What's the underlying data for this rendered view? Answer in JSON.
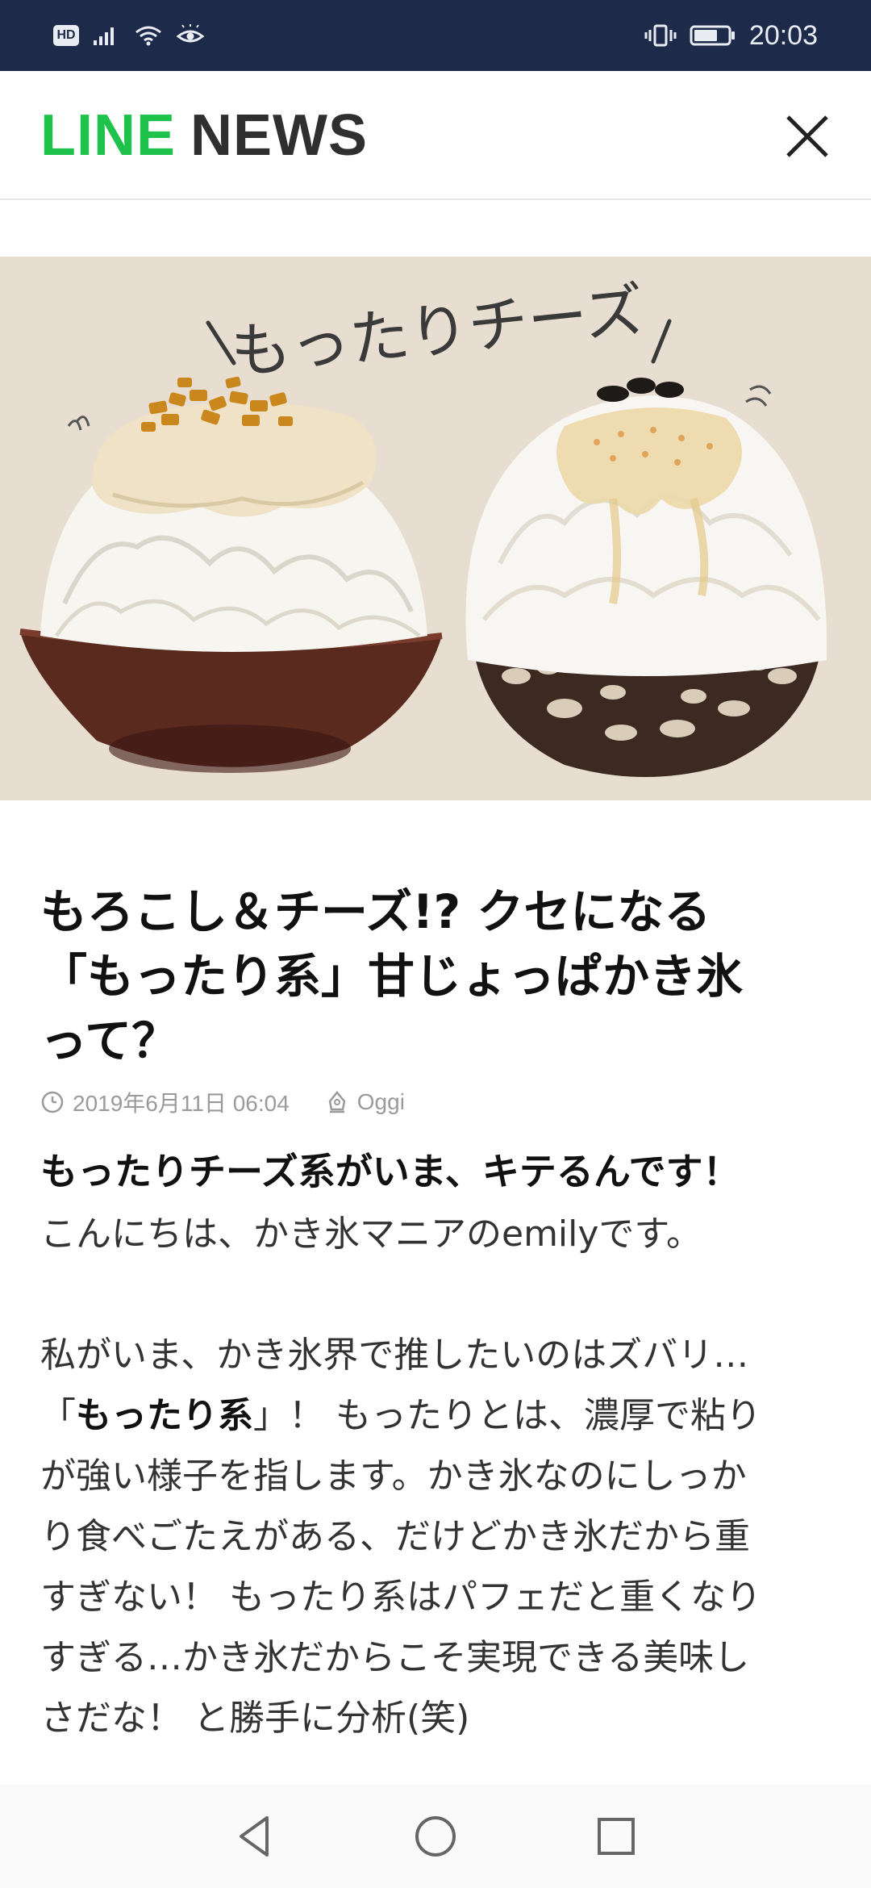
{
  "status_bar": {
    "hd_label": "HD",
    "time": "20:03",
    "icons": [
      "signal-icon",
      "wifi-icon",
      "eye-icon",
      "vibrate-icon",
      "battery-icon"
    ]
  },
  "header": {
    "logo_line": "LINE",
    "logo_news": "NEWS",
    "close_icon": "close-icon"
  },
  "hero": {
    "handwritten_text": "もったりチーズ",
    "background_color": "#e8ddd1"
  },
  "article": {
    "title_lines": [
      "もろこし＆チーズ!? クセになる",
      "「もったり系」甘じょっぱかき氷",
      "って？"
    ],
    "date": "2019年6月11日 06:04",
    "source": "Oggi",
    "subheading": "もったりチーズ系がいま、キテるんです！",
    "intro": "こんにちは、かき氷マニアのemilyです。",
    "para2": {
      "line1": "私がいま、かき氷界で推したいのはズバリ…",
      "bold": "もったり系",
      "open_bracket": "「",
      "close_bracket": "」！ もったりとは、濃厚で粘り",
      "line3": "が強い様子を指します。かき氷なのにしっか",
      "line4": "り食べごたえがある、だけどかき氷だから重",
      "line5": "すぎない！ もったり系はパフェだと重くなり",
      "line6": "すぎる…かき氷だからこそ実現できる美味し",
      "line7": "さだな！ と勝手に分析(笑)"
    }
  },
  "nav": {
    "back": "back-icon",
    "home": "home-icon",
    "recents": "recents-icon"
  },
  "colors": {
    "status_bar": "#1d2a4a",
    "line_green": "#1fc24a",
    "news_dark": "#2f2f2f"
  }
}
